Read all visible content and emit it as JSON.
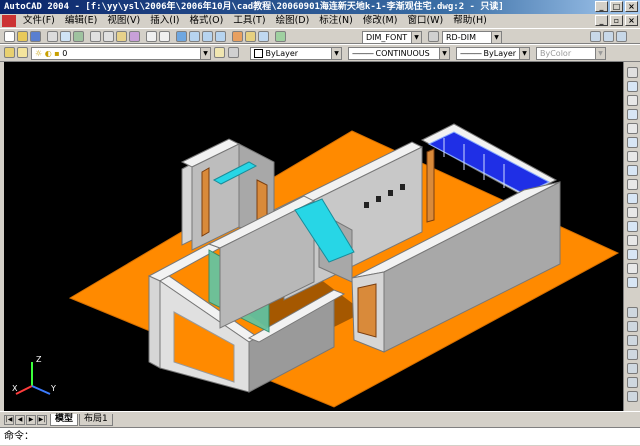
{
  "window": {
    "title": "AutoCAD 2004 - [f:\\yy\\ysl\\2006年\\2006年10月\\cad教程\\20060901海连新天地k-1-李渐观住宅.dwg:2 - 只读]"
  },
  "menu": {
    "items": [
      "文件(F)",
      "编辑(E)",
      "视图(V)",
      "插入(I)",
      "格式(O)",
      "工具(T)",
      "绘图(D)",
      "标注(N)",
      "修改(M)",
      "窗口(W)",
      "帮助(H)"
    ]
  },
  "toolbar": {
    "textstyle": "DIM_FONT",
    "dimstyle": "RD-DIM"
  },
  "properties": {
    "layer": "0",
    "color": "ByLayer",
    "linetype": "CONTINUOUS",
    "lineweight": "ByLayer",
    "plotstyle": "ByColor"
  },
  "layout_tabs": [
    "模型",
    "布局1"
  ],
  "command": {
    "prompt": "命令："
  },
  "ucs": {
    "z": "Z",
    "x": "X",
    "y": "Y"
  },
  "colors": {
    "viewport_bg": "#000000",
    "floor": "#ff8a00",
    "wall_top": "#f2f2f2",
    "wall_left": "#d6d6d6",
    "wall_right": "#a8a8a8",
    "beam": "#27d6e6",
    "glass": "#1f2fe6",
    "door": "#d98a3a"
  }
}
